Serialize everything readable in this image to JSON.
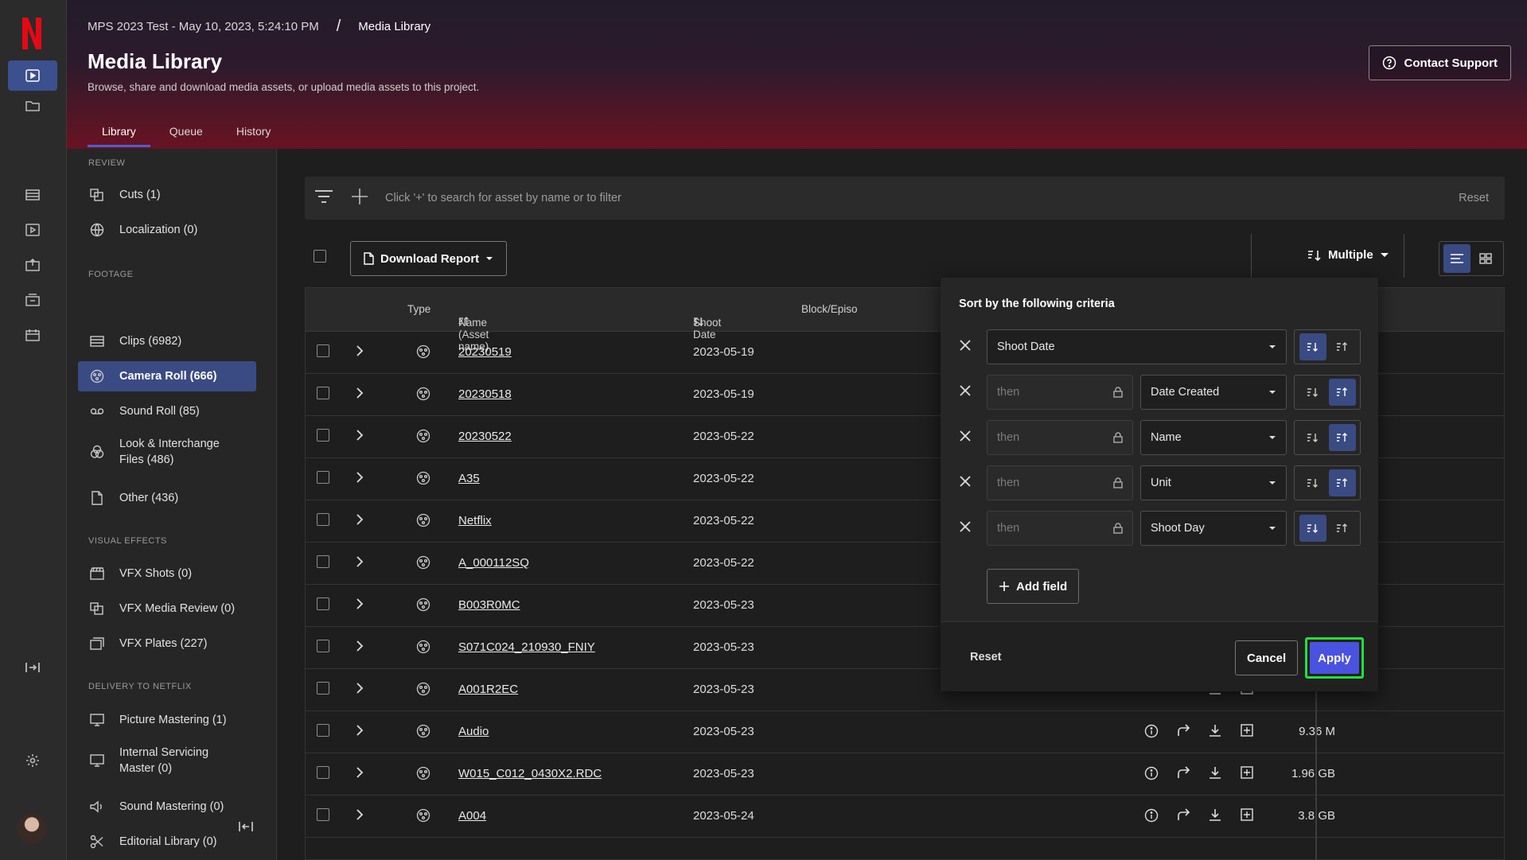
{
  "header": {
    "breadcrumb_project": "MPS 2023 Test - May 10, 2023, 5:24:10 PM",
    "breadcrumb_sep": "/",
    "breadcrumb_current": "Media Library",
    "title": "Media Library",
    "subtitle": "Browse, share and download media assets, or upload media assets to this project.",
    "contact_label": "Contact Support",
    "tabs": [
      {
        "label": "Library"
      },
      {
        "label": "Queue"
      },
      {
        "label": "History"
      }
    ]
  },
  "sidebar": {
    "sections": {
      "review": "REVIEW",
      "footage": "FOOTAGE",
      "vfx": "VISUAL EFFECTS",
      "delivery": "DELIVERY TO NETFLIX"
    },
    "items": [
      {
        "label": "Cuts (1)",
        "icon": "cuts-icon"
      },
      {
        "label": "Localization (0)",
        "icon": "globe-icon"
      },
      {
        "label": "Clips (6982)",
        "icon": "film-icon"
      },
      {
        "label": "Camera Roll (666)",
        "icon": "camera-roll-icon"
      },
      {
        "label": "Sound Roll (85)",
        "icon": "tape-icon"
      },
      {
        "label": "Look & Interchange Files (486)",
        "icon": "look-icon"
      },
      {
        "label": "Other (436)",
        "icon": "file-icon"
      },
      {
        "label": "VFX Shots (0)",
        "icon": "clapper-icon"
      },
      {
        "label": "VFX Media Review (0)",
        "icon": "review-icon"
      },
      {
        "label": "VFX Plates (227)",
        "icon": "plates-icon"
      },
      {
        "label": "Picture Mastering (1)",
        "icon": "monitor-icon"
      },
      {
        "label": "Internal Servicing Master (0)",
        "icon": "monitor-icon"
      },
      {
        "label": "Sound Mastering (0)",
        "icon": "speaker-icon"
      },
      {
        "label": "Editorial Library (0)",
        "icon": "scissors-icon"
      }
    ]
  },
  "search": {
    "hint": "Click '+' to search for asset by name or to filter",
    "reset": "Reset"
  },
  "toolbar": {
    "download_report": "Download Report",
    "sort_label": "Multiple"
  },
  "table": {
    "headers": {
      "type": "Type",
      "name": "Name (Asset name)",
      "name_sort": "2",
      "shoot_date": "Shoot Date",
      "shoot_sort": "1",
      "block": "Block/Episo"
    },
    "rows": [
      {
        "name": "20230519",
        "date": "2023-05-19",
        "size": "",
        "extra": false
      },
      {
        "name": "20230518",
        "date": "2023-05-19",
        "size": "",
        "extra": false
      },
      {
        "name": "20230522",
        "date": "2023-05-22",
        "size": "",
        "extra": false
      },
      {
        "name": "A35",
        "date": "2023-05-22",
        "size": "",
        "extra": false
      },
      {
        "name": "Netflix",
        "date": "2023-05-22",
        "size": "",
        "extra": false
      },
      {
        "name": "A_000112SQ",
        "date": "2023-05-22",
        "size": "",
        "extra": false
      },
      {
        "name": "B003R0MC",
        "date": "2023-05-23",
        "size": "",
        "extra": false
      },
      {
        "name": "S071C024_210930_FNIY",
        "date": "2023-05-23",
        "size": "",
        "extra": false
      },
      {
        "name": "A001R2EC",
        "date": "2023-05-23",
        "size": "",
        "extra": false
      },
      {
        "name": "Audio",
        "date": "2023-05-23",
        "size": "9.36 M",
        "extra": true
      },
      {
        "name": "W015_C012_0430X2.RDC",
        "date": "2023-05-23",
        "size": "1.96 GB",
        "extra": true
      },
      {
        "name": "A004",
        "date": "2023-05-24",
        "size": "3.8 GB",
        "extra": true
      }
    ]
  },
  "sort_popover": {
    "title": "Sort by the following criteria",
    "then_placeholder": "then",
    "criteria": [
      {
        "field": "Shoot Date",
        "direction": "desc"
      },
      {
        "field": "Date Created",
        "direction": "asc"
      },
      {
        "field": "Name",
        "direction": "asc"
      },
      {
        "field": "Unit",
        "direction": "asc"
      },
      {
        "field": "Shoot Day",
        "direction": "desc"
      }
    ],
    "add_field": "Add field",
    "reset": "Reset",
    "cancel": "Cancel",
    "apply": "Apply"
  },
  "colors": {
    "accent": "#4a52e0",
    "active_nav": "#3a4a83",
    "highlight": "#22e03a",
    "brand": "#e50914"
  }
}
